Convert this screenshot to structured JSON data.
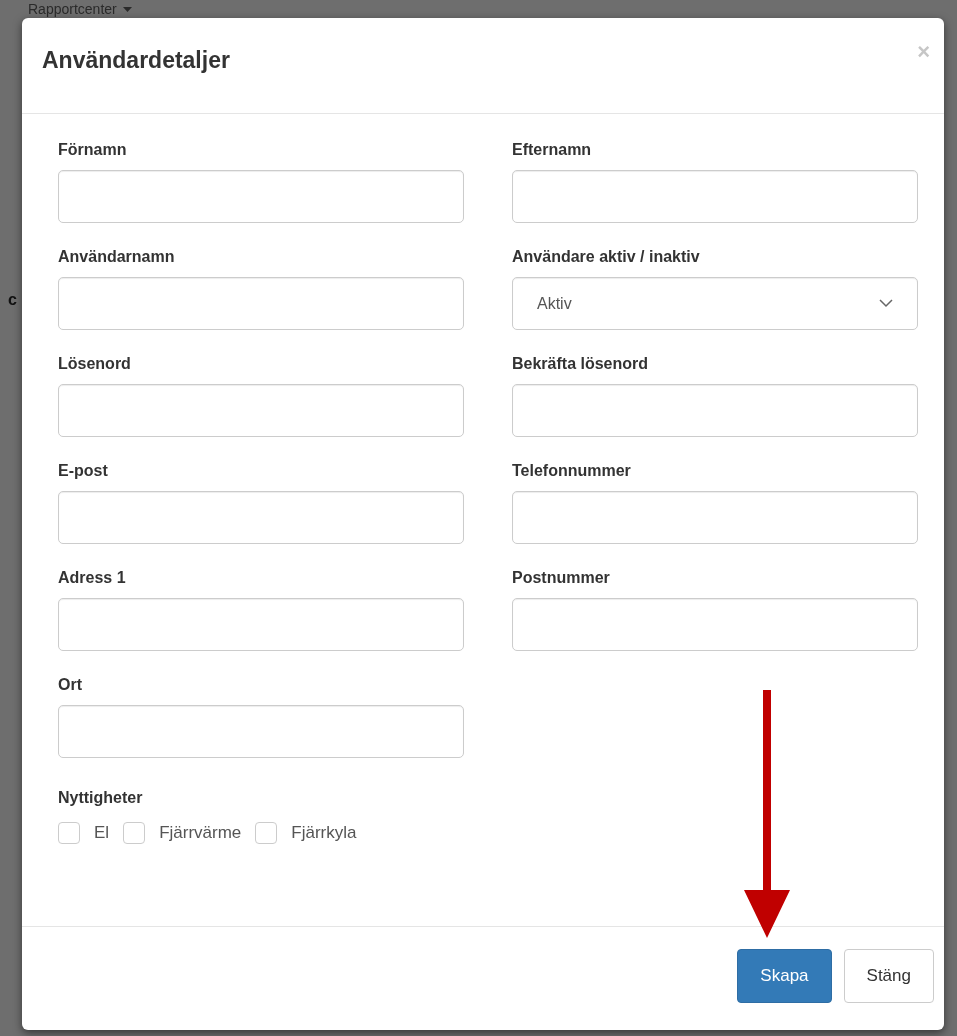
{
  "background": {
    "menu_label": "Rapportcenter",
    "side_letter": "c"
  },
  "modal": {
    "title": "Användardetaljer",
    "close": "×",
    "fields": [
      {
        "kind": "text",
        "label": "Förnamn"
      },
      {
        "kind": "text",
        "label": "Efternamn"
      },
      {
        "kind": "text",
        "label": "Användarnamn"
      },
      {
        "kind": "select",
        "label": "Användare aktiv / inaktiv",
        "value": "Aktiv"
      },
      {
        "kind": "password",
        "label": "Lösenord"
      },
      {
        "kind": "password",
        "label": "Bekräfta lösenord"
      },
      {
        "kind": "text",
        "label": "E-post"
      },
      {
        "kind": "text",
        "label": "Telefonnummer"
      },
      {
        "kind": "text",
        "label": "Adress 1"
      },
      {
        "kind": "text",
        "label": "Postnummer"
      },
      {
        "kind": "text",
        "label": "Ort"
      }
    ],
    "utilities": {
      "label": "Nyttigheter",
      "options": [
        {
          "label": "El",
          "checked": false
        },
        {
          "label": "Fjärrvärme",
          "checked": false
        },
        {
          "label": "Fjärrkyla",
          "checked": false
        }
      ]
    },
    "buttons": [
      {
        "label": "Skapa",
        "kind": "primary"
      },
      {
        "label": "Stäng",
        "kind": "default"
      }
    ]
  }
}
